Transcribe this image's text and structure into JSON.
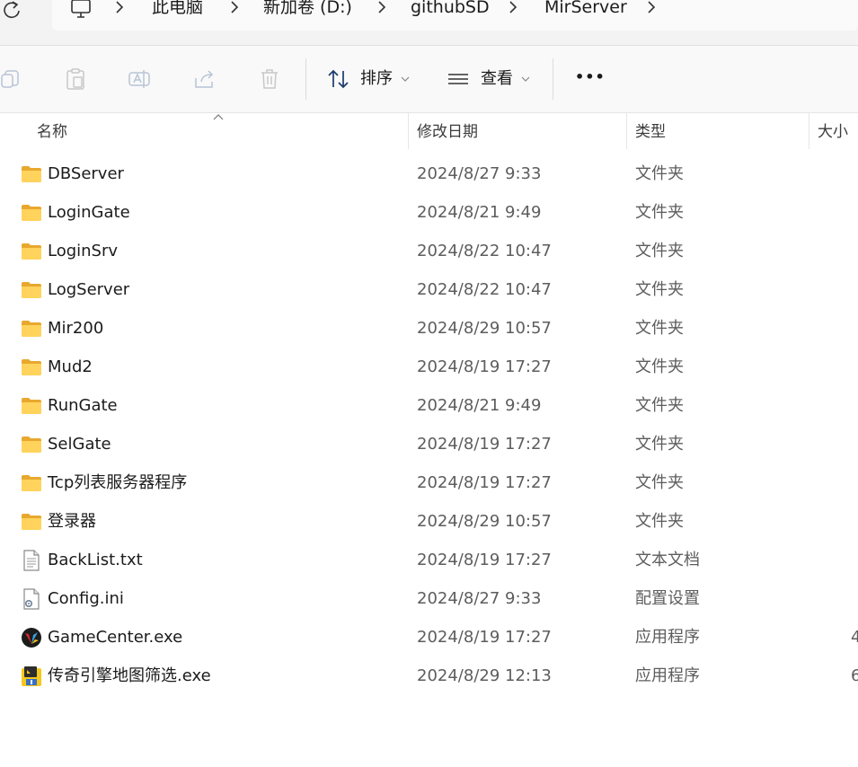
{
  "breadcrumb": {
    "items": [
      "此电脑",
      "新加卷 (D:)",
      "githubSD",
      "MirServer"
    ]
  },
  "toolbar": {
    "sort_label": "排序",
    "view_label": "查看",
    "more_label": "•••"
  },
  "columns": {
    "name": "名称",
    "date": "修改日期",
    "type": "类型",
    "size": "大小"
  },
  "files": [
    {
      "name": "DBServer",
      "date": "2024/8/27 9:33",
      "type": "文件夹",
      "size": "",
      "icon": "folder-icon"
    },
    {
      "name": "LoginGate",
      "date": "2024/8/21 9:49",
      "type": "文件夹",
      "size": "",
      "icon": "folder-icon"
    },
    {
      "name": "LoginSrv",
      "date": "2024/8/22 10:47",
      "type": "文件夹",
      "size": "",
      "icon": "folder-icon"
    },
    {
      "name": "LogServer",
      "date": "2024/8/22 10:47",
      "type": "文件夹",
      "size": "",
      "icon": "folder-icon"
    },
    {
      "name": "Mir200",
      "date": "2024/8/29 10:57",
      "type": "文件夹",
      "size": "",
      "icon": "folder-icon"
    },
    {
      "name": "Mud2",
      "date": "2024/8/19 17:27",
      "type": "文件夹",
      "size": "",
      "icon": "folder-icon"
    },
    {
      "name": "RunGate",
      "date": "2024/8/21 9:49",
      "type": "文件夹",
      "size": "",
      "icon": "folder-icon"
    },
    {
      "name": "SelGate",
      "date": "2024/8/19 17:27",
      "type": "文件夹",
      "size": "",
      "icon": "folder-icon"
    },
    {
      "name": "Tcp列表服务器程序",
      "date": "2024/8/19 17:27",
      "type": "文件夹",
      "size": "",
      "icon": "folder-icon"
    },
    {
      "name": "登录器",
      "date": "2024/8/29 10:57",
      "type": "文件夹",
      "size": "",
      "icon": "folder-icon"
    },
    {
      "name": "BackList.txt",
      "date": "2024/8/19 17:27",
      "type": "文本文档",
      "size": "",
      "icon": "text-file-icon"
    },
    {
      "name": "Config.ini",
      "date": "2024/8/27 9:33",
      "type": "配置设置",
      "size": "",
      "icon": "config-file-icon"
    },
    {
      "name": "GameCenter.exe",
      "date": "2024/8/19 17:27",
      "type": "应用程序",
      "size": "4",
      "icon": "gamecenter-app-icon"
    },
    {
      "name": "传奇引擎地图筛选.exe",
      "date": "2024/8/29 12:13",
      "type": "应用程序",
      "size": "6",
      "icon": "map-filter-app-icon"
    }
  ]
}
